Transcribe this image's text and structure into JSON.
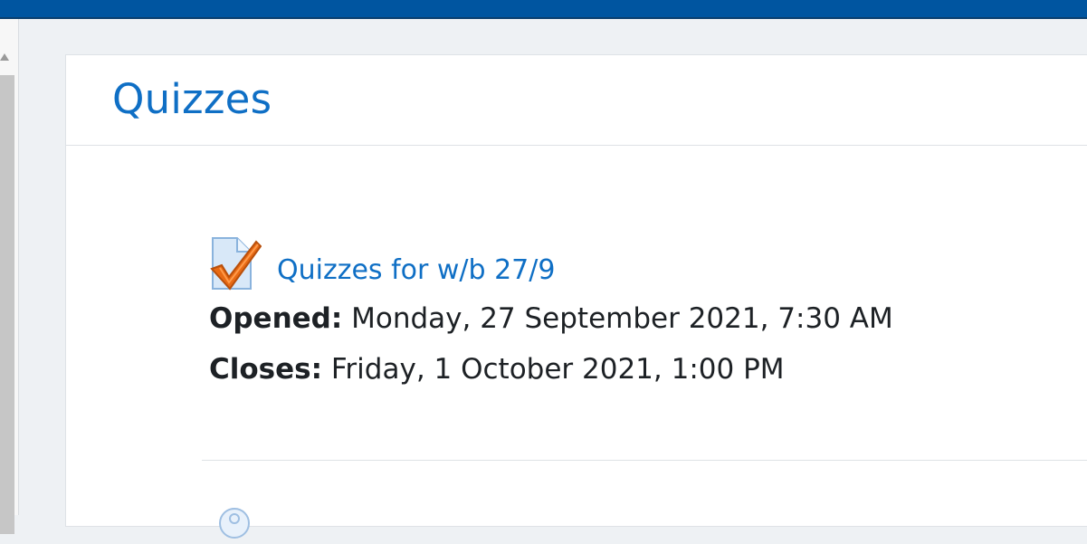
{
  "page": {
    "title": "Quizzes"
  },
  "activity": {
    "icon": "quiz-icon",
    "link_text": "Quizzes for w/b 27/9",
    "opened_label": "Opened:",
    "opened_value": "Monday, 27 September 2021, 7:30 AM",
    "closes_label": "Closes:",
    "closes_value": "Friday, 1 October 2021, 1:00 PM"
  },
  "next_item": {
    "icon": "activity-icon"
  },
  "colors": {
    "topbar": "#0055a0",
    "link": "#0f6fc5",
    "text": "#1d2125",
    "quiz_check": "#e86a14"
  }
}
